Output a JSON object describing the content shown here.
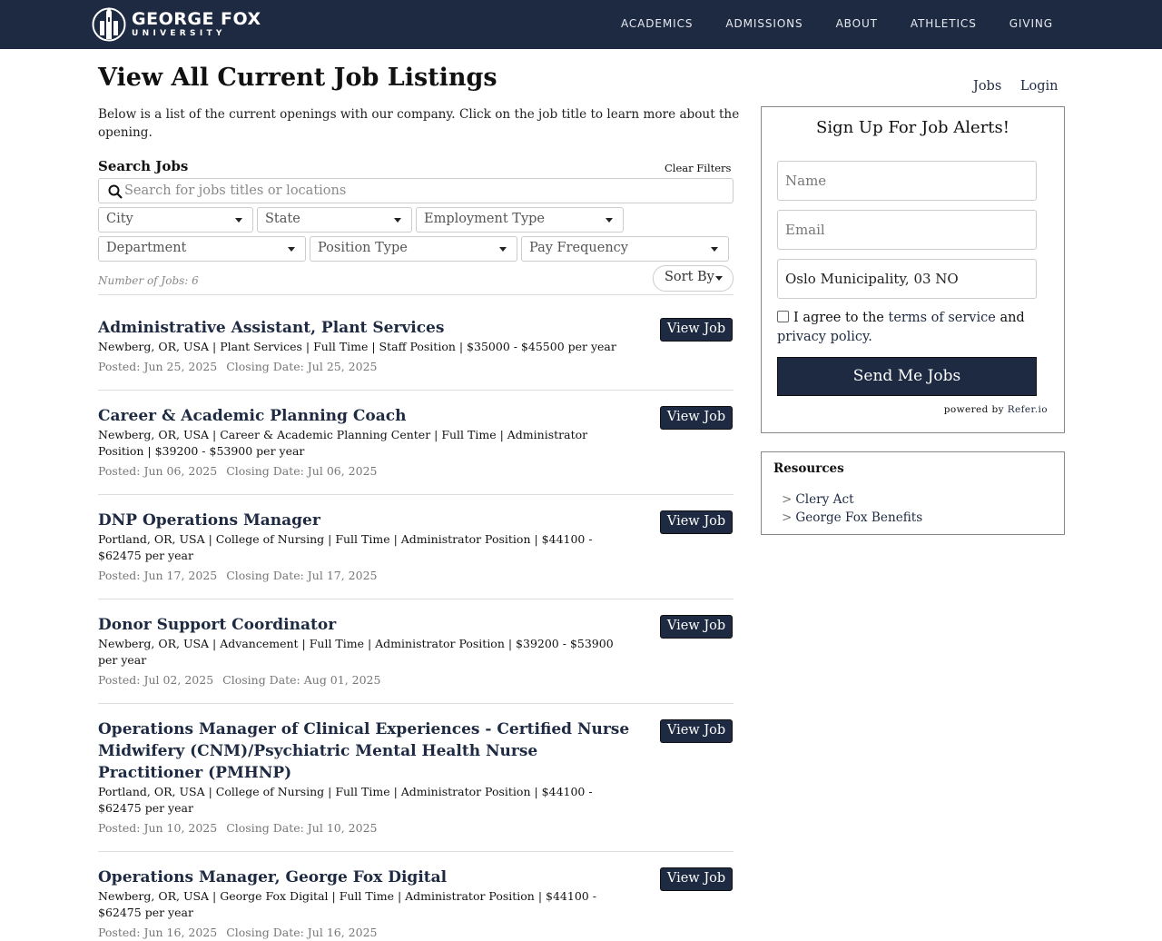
{
  "header": {
    "logo_name": "GEORGE FOX",
    "logo_sub": "UNIVERSITY",
    "nav": [
      "ACADEMICS",
      "ADMISSIONS",
      "ABOUT",
      "ATHLETICS",
      "GIVING"
    ]
  },
  "page": {
    "title": "View All Current Job Listings",
    "intro": "Below is a list of the current openings with our company. Click on the job title to learn more about the opening."
  },
  "search": {
    "label": "Search Jobs",
    "clear_filters": "Clear Filters",
    "placeholder": "Search for jobs titles or locations",
    "filters": [
      "City",
      "State",
      "Employment Type",
      "Department",
      "Position Type",
      "Pay Frequency"
    ],
    "count": "Number of Jobs: 6",
    "sort_by": "Sort By"
  },
  "jobs": [
    {
      "title": "Administrative Assistant, Plant Services",
      "meta": "Newberg, OR, USA | Plant Services | Full Time | Staff Position | $35000 - $45500 per year",
      "posted": "Posted: Jun 25, 2025",
      "closing": "Closing Date: Jul 25, 2025",
      "button": "View Job"
    },
    {
      "title": "Career & Academic Planning Coach",
      "meta": "Newberg, OR, USA | Career & Academic Planning Center | Full Time | Administrator Position | $39200 - $53900 per year",
      "posted": "Posted: Jun 06, 2025",
      "closing": "Closing Date: Jul 06, 2025",
      "button": "View Job"
    },
    {
      "title": "DNP Operations Manager",
      "meta": "Portland, OR, USA | College of Nursing | Full Time | Administrator Position | $44100 - $62475 per year",
      "posted": "Posted: Jun 17, 2025",
      "closing": "Closing Date: Jul 17, 2025",
      "button": "View Job"
    },
    {
      "title": "Donor Support Coordinator",
      "meta": "Newberg, OR, USA | Advancement | Full Time | Administrator Position | $39200 - $53900 per year",
      "posted": "Posted: Jul 02, 2025",
      "closing": "Closing Date: Aug 01, 2025",
      "button": "View Job"
    },
    {
      "title": "Operations Manager of Clinical Experiences - Certified Nurse Midwifery (CNM)/Psychiatric Mental Health Nurse Practitioner (PMHNP)",
      "meta": "Portland, OR, USA | College of Nursing | Full Time | Administrator Position | $44100 - $62475 per year",
      "posted": "Posted: Jun 10, 2025",
      "closing": "Closing Date: Jul 10, 2025",
      "button": "View Job"
    },
    {
      "title": "Operations Manager, George Fox Digital",
      "meta": "Newberg, OR, USA | George Fox Digital | Full Time | Administrator Position | $44100 - $62475 per year",
      "posted": "Posted: Jun 16, 2025",
      "closing": "Closing Date: Jul 16, 2025",
      "button": "View Job"
    }
  ],
  "toplinks": {
    "jobs": "Jobs",
    "login": "Login"
  },
  "signup": {
    "title": "Sign Up For Job Alerts!",
    "name_placeholder": "Name",
    "email_placeholder": "Email",
    "location_value": "Oslo Municipality, 03 NO",
    "agree_prefix": "I agree to the",
    "terms": "terms of service",
    "and": "and",
    "privacy": "privacy policy.",
    "button": "Send Me Jobs",
    "powered_by": "powered by",
    "powered_link": "Refer.io"
  },
  "resources": {
    "title": "Resources",
    "links": [
      "Clery Act",
      "George Fox Benefits"
    ]
  }
}
